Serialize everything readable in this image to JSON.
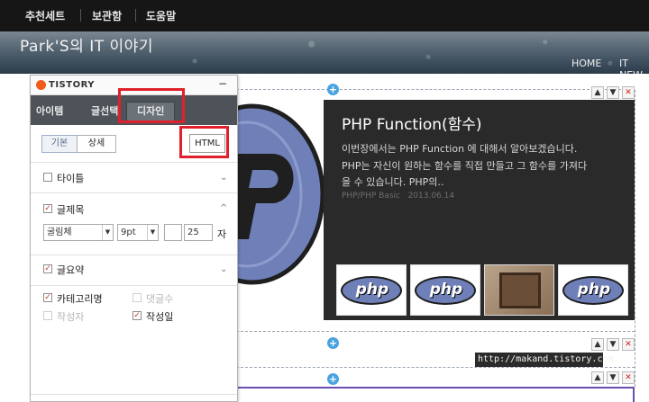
{
  "topbar": {
    "items": [
      "추천세트",
      "보관함",
      "도움말"
    ]
  },
  "banner": {
    "blog_title": "Park'S의 IT 이야기",
    "nav": [
      "HOME",
      "IT NEW"
    ]
  },
  "post": {
    "title": "PHP Function(함수)",
    "summary_lines": [
      "이번장에서는 PHP Function 에 대해서 알아보겠습니다.",
      "PHP는 자신이 원하는 함수를 직접 만들고 그 함수를 가져다",
      "을 수 있습니다. PHP의.."
    ],
    "category": "PHP/PHP Basic",
    "date": "2013.06.14",
    "thumb_text": "php"
  },
  "tooltip": {
    "url": "http://makand.tistory.com"
  },
  "panel": {
    "logo": "TISTORY",
    "minimize": "−",
    "tabs": [
      "아이템",
      "글선택",
      "디자인"
    ],
    "subtabs": [
      "기본",
      "상세"
    ],
    "html_button": "HTML",
    "sections": {
      "title": "타이틀",
      "post_title": "글제목",
      "summary": "글요약"
    },
    "font": {
      "family": "굴림체",
      "size": "9pt",
      "number": "25",
      "unit": "자"
    },
    "options": {
      "category": "카테고리명",
      "comments": "댓글수",
      "author": "작성자",
      "date": "작성일"
    }
  },
  "controls": {
    "up": "▲",
    "down": "▼",
    "close": "✕",
    "plus": "+"
  },
  "colors": {
    "highlight": "#e0202a",
    "card_bg": "#2a2a2a",
    "accent_blue": "#4aa3e0"
  }
}
